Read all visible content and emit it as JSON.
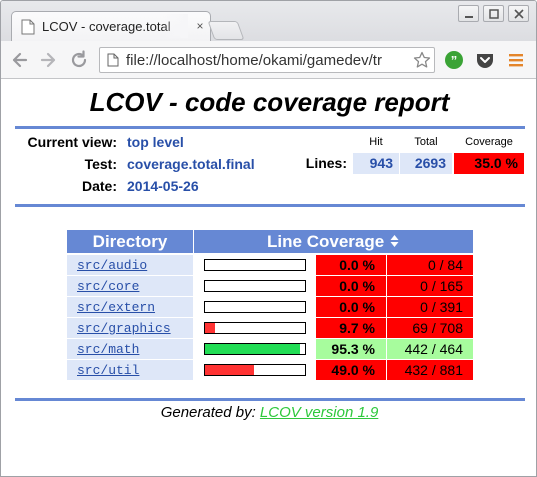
{
  "browser": {
    "tab_title": "LCOV - coverage.total",
    "tab_close": "×",
    "url": "file://localhost/home/okami/gamedev/tr"
  },
  "report": {
    "title": "LCOV - code coverage report",
    "current_view_label": "Current view:",
    "current_view_value": "top level",
    "test_label": "Test:",
    "test_value": "coverage.total.final",
    "date_label": "Date:",
    "date_value": "2014-05-26",
    "summary": {
      "hit_header": "Hit",
      "total_header": "Total",
      "coverage_header": "Coverage",
      "lines_label": "Lines:",
      "hit": "943",
      "total": "2693",
      "coverage": "35.0 %"
    }
  },
  "table": {
    "header_directory": "Directory",
    "header_line_coverage": "Line Coverage",
    "rows": [
      {
        "dir": "src/audio",
        "rate": "0.0 %",
        "hits": "0 / 84",
        "fill": 0.0
      },
      {
        "dir": "src/core",
        "rate": "0.0 %",
        "hits": "0 / 165",
        "fill": 0.0
      },
      {
        "dir": "src/extern",
        "rate": "0.0 %",
        "hits": "0 / 391",
        "fill": 0.0
      },
      {
        "dir": "src/graphics",
        "rate": "9.7 %",
        "hits": "69 / 708",
        "fill": 0.097
      },
      {
        "dir": "src/math",
        "rate": "95.3 %",
        "hits": "442 / 464",
        "fill": 0.953
      },
      {
        "dir": "src/util",
        "rate": "49.0 %",
        "hits": "432 / 881",
        "fill": 0.49
      }
    ]
  },
  "footer": {
    "generated_by": "Generated by:",
    "link_text": "LCOV version 1.9"
  },
  "colors": {
    "low": "#ff0000",
    "high": "#a7fc9d",
    "bar_low": "#ff3333",
    "bar_high": "#22dd55",
    "summary_num_bg": "#dee7f8",
    "accent": "#6688d4",
    "link": "#284fa8"
  }
}
